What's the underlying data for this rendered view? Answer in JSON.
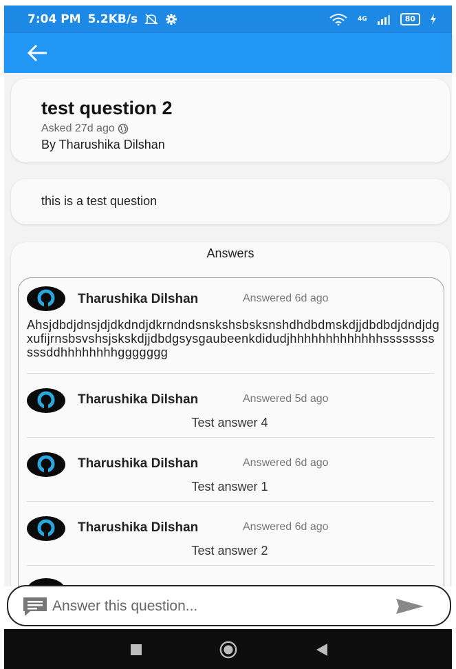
{
  "status_bar": {
    "time": "7:04 PM",
    "net_speed": "5.2KB/s",
    "signal": "4G",
    "battery": "80"
  },
  "app_bar": {
    "back_icon": "arrow-back-icon"
  },
  "question": {
    "title": "test question 2",
    "asked": "Asked 27d ago",
    "by": "By Tharushika Dilshan",
    "body": "this is a test question"
  },
  "answers": {
    "heading": "Answers",
    "items": [
      {
        "author": "Tharushika Dilshan",
        "time": "Answered 6d ago",
        "text": "Ahsjdbdjdnsjdjdkdndjdkrndndsnskshsbsksnshdhdbdmskdjjdbdbdjdndjdgxufijrnsbsvshsjskskdjjdbdgsysgaubeenkdidudjhhhhhhhhhhhhhsssssssssssddhhhhhhhhggggggg"
      },
      {
        "author": "Tharushika Dilshan",
        "time": "Answered 5d ago",
        "text": "Test answer 4"
      },
      {
        "author": "Tharushika Dilshan",
        "time": "Answered 6d ago",
        "text": "Test answer 1"
      },
      {
        "author": "Tharushika Dilshan",
        "time": "Answered 6d ago",
        "text": "Test answer 2"
      }
    ]
  },
  "answer_input": {
    "placeholder": "Answer this question...",
    "value": ""
  },
  "colors": {
    "status_bar": "#1e88e5",
    "app_bar": "#2196f3",
    "avatar_ring": "#29a8e0",
    "background": "#f3f3f3"
  }
}
